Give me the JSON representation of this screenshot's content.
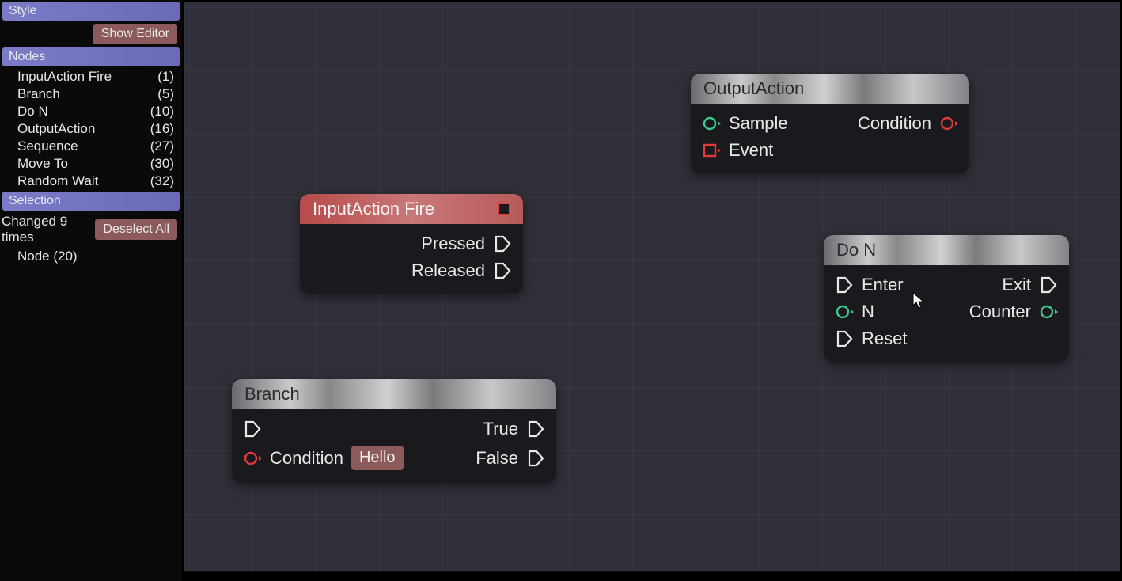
{
  "sidebar": {
    "style_header": "Style",
    "show_editor": "Show Editor",
    "nodes_header": "Nodes",
    "node_items": [
      {
        "name": "InputAction Fire",
        "count": "(1)"
      },
      {
        "name": "Branch",
        "count": "(5)"
      },
      {
        "name": "Do N",
        "count": "(10)"
      },
      {
        "name": "OutputAction",
        "count": "(16)"
      },
      {
        "name": "Sequence",
        "count": "(27)"
      },
      {
        "name": "Move To",
        "count": "(30)"
      },
      {
        "name": "Random Wait",
        "count": "(32)"
      }
    ],
    "selection_header": "Selection",
    "changed_text": "Changed 9 times",
    "deselect_all": "Deselect All",
    "selected_node": "Node (20)"
  },
  "nodes": {
    "input_action": {
      "title": "InputAction Fire",
      "out_pressed": "Pressed",
      "out_released": "Released"
    },
    "branch": {
      "title": "Branch",
      "in_condition": "Condition",
      "cond_value": "Hello",
      "out_true": "True",
      "out_false": "False"
    },
    "output_action": {
      "title": "OutputAction",
      "in_sample": "Sample",
      "in_event": "Event",
      "out_condition": "Condition"
    },
    "do_n": {
      "title": "Do N",
      "in_enter": "Enter",
      "in_n": "N",
      "in_reset": "Reset",
      "out_exit": "Exit",
      "out_counter": "Counter"
    }
  },
  "colors": {
    "exec": "#e8e8e8",
    "data_green": "#3ec98e",
    "data_red": "#e03a3a"
  }
}
